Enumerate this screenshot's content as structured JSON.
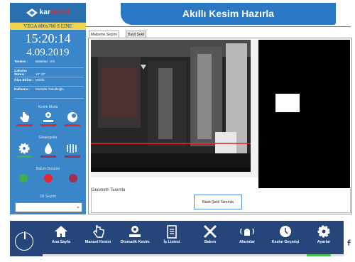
{
  "sidebar": {
    "brand_main": "kar",
    "brand_accent": "metal",
    "brand_sub": "premium",
    "model": "VEGA 800x700 S LINE",
    "clock": "15:20:14",
    "date": "4.09.2019",
    "info": [
      {
        "key": "Testere :",
        "value": "BkMetal - 2/3"
      },
      {
        "key": "Çalışma Süresi :",
        "value": "12' 32\""
      },
      {
        "key": "Ölçü Birimi :",
        "value": "Metrik"
      },
      {
        "key": "Kullanıcı :",
        "value": "Mustafa Yakutkoğlu"
      }
    ],
    "kesim_modu": "Kesim Modu",
    "gostergeler": "Göstergeler",
    "bakim_durumu": "Bakım Durumu",
    "dil_secimi": "Dil Seçimi",
    "colors": {
      "red": "#e8262c",
      "green": "#3fb049",
      "yellow": "#f2d34c",
      "dark_red": "#9c3253"
    }
  },
  "header": {
    "title": "Akıllı Kesim Hazırla"
  },
  "tabs": [
    {
      "label": "Malzeme Seçimi",
      "active": true
    },
    {
      "label": "Basit Şekil",
      "active": false
    }
  ],
  "main": {
    "geometri_label": "Geometri Tanımla",
    "basit_button": "Basit Şekil Tanımla"
  },
  "nav": [
    {
      "label": "Ana Sayfa",
      "icon": "home-icon"
    },
    {
      "label": "Manuel Kesim",
      "icon": "hand-pointer-icon"
    },
    {
      "label": "Otomatik Kesim",
      "icon": "auto-gear-icon"
    },
    {
      "label": "İş Listesi",
      "icon": "clipboard-icon"
    },
    {
      "label": "Bakım",
      "icon": "tools-icon"
    },
    {
      "label": "Alarmlar",
      "icon": "alarm-icon"
    },
    {
      "label": "Kesim Geçmişi",
      "icon": "clock-icon"
    },
    {
      "label": "Ayarlar",
      "icon": "settings-gear-icon"
    }
  ]
}
